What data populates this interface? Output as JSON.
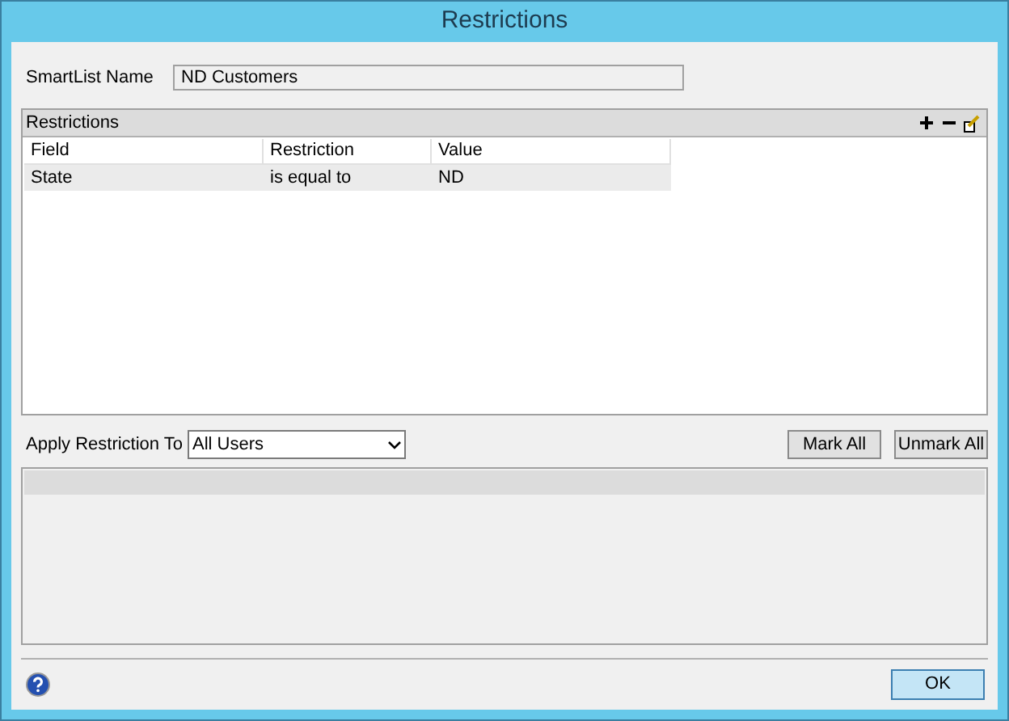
{
  "window": {
    "title": "Restrictions"
  },
  "smartlist_name": {
    "label": "SmartList Name",
    "value": "ND Customers"
  },
  "restrictions": {
    "title": "Restrictions",
    "columns": [
      "Field",
      "Restriction",
      "Value"
    ],
    "rows": [
      {
        "cells": [
          "State",
          "is equal to",
          "ND"
        ],
        "selected": true
      }
    ]
  },
  "apply": {
    "label": "Apply Restriction To",
    "value": "All Users"
  },
  "buttons": [
    "Mark All",
    "Unmark All"
  ],
  "ok": "OK"
}
